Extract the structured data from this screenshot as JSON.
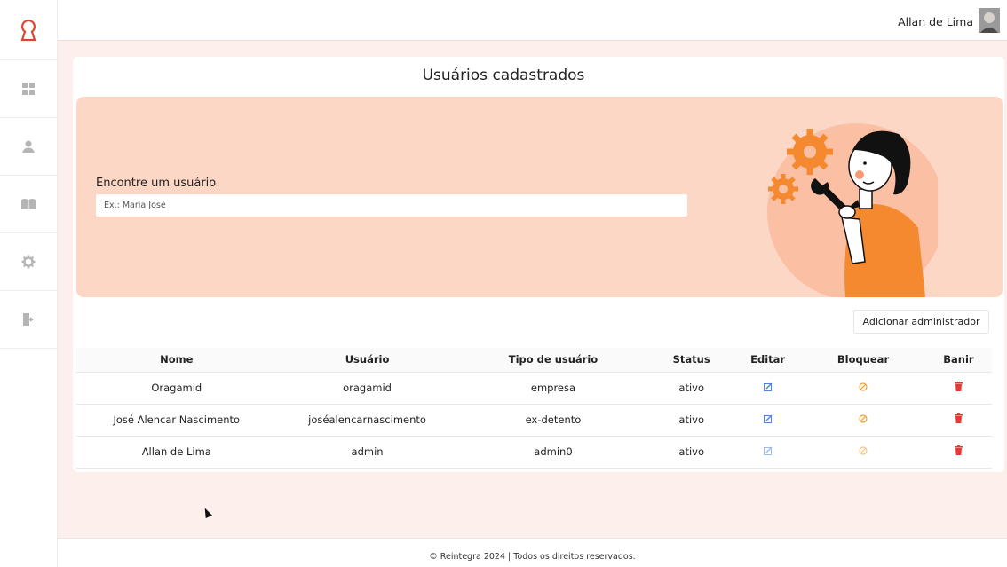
{
  "app": {
    "user_name": "Allan de Lima",
    "accent": "#e0442f"
  },
  "sidebar": {
    "logo": "keyhole-logo",
    "items": [
      {
        "icon": "dashboard-icon"
      },
      {
        "icon": "user-icon"
      },
      {
        "icon": "book-icon"
      },
      {
        "icon": "gear-icon"
      },
      {
        "icon": "logout-icon"
      }
    ]
  },
  "main": {
    "title": "Usuários cadastrados",
    "search": {
      "label": "Encontre um usuário",
      "placeholder": "Ex.: Maria José",
      "value": ""
    },
    "add_admin_label": "Adicionar administrador",
    "table": {
      "headers": {
        "nome": "Nome",
        "usuario": "Usuário",
        "tipo": "Tipo de usuário",
        "status": "Status",
        "editar": "Editar",
        "bloquear": "Bloquear",
        "banir": "Banir"
      },
      "rows": [
        {
          "nome": "Oragamid",
          "usuario": "oragamid",
          "tipo": "empresa",
          "status": "ativo"
        },
        {
          "nome": "José Alencar Nascimento",
          "usuario": "joséalencarnascimento",
          "tipo": "ex-detento",
          "status": "ativo"
        },
        {
          "nome": "Allan de Lima",
          "usuario": "admin",
          "tipo": "admin0",
          "status": "ativo"
        }
      ]
    }
  },
  "footer": {
    "text": "© Reintegra 2024 | Todos os direitos reservados."
  }
}
